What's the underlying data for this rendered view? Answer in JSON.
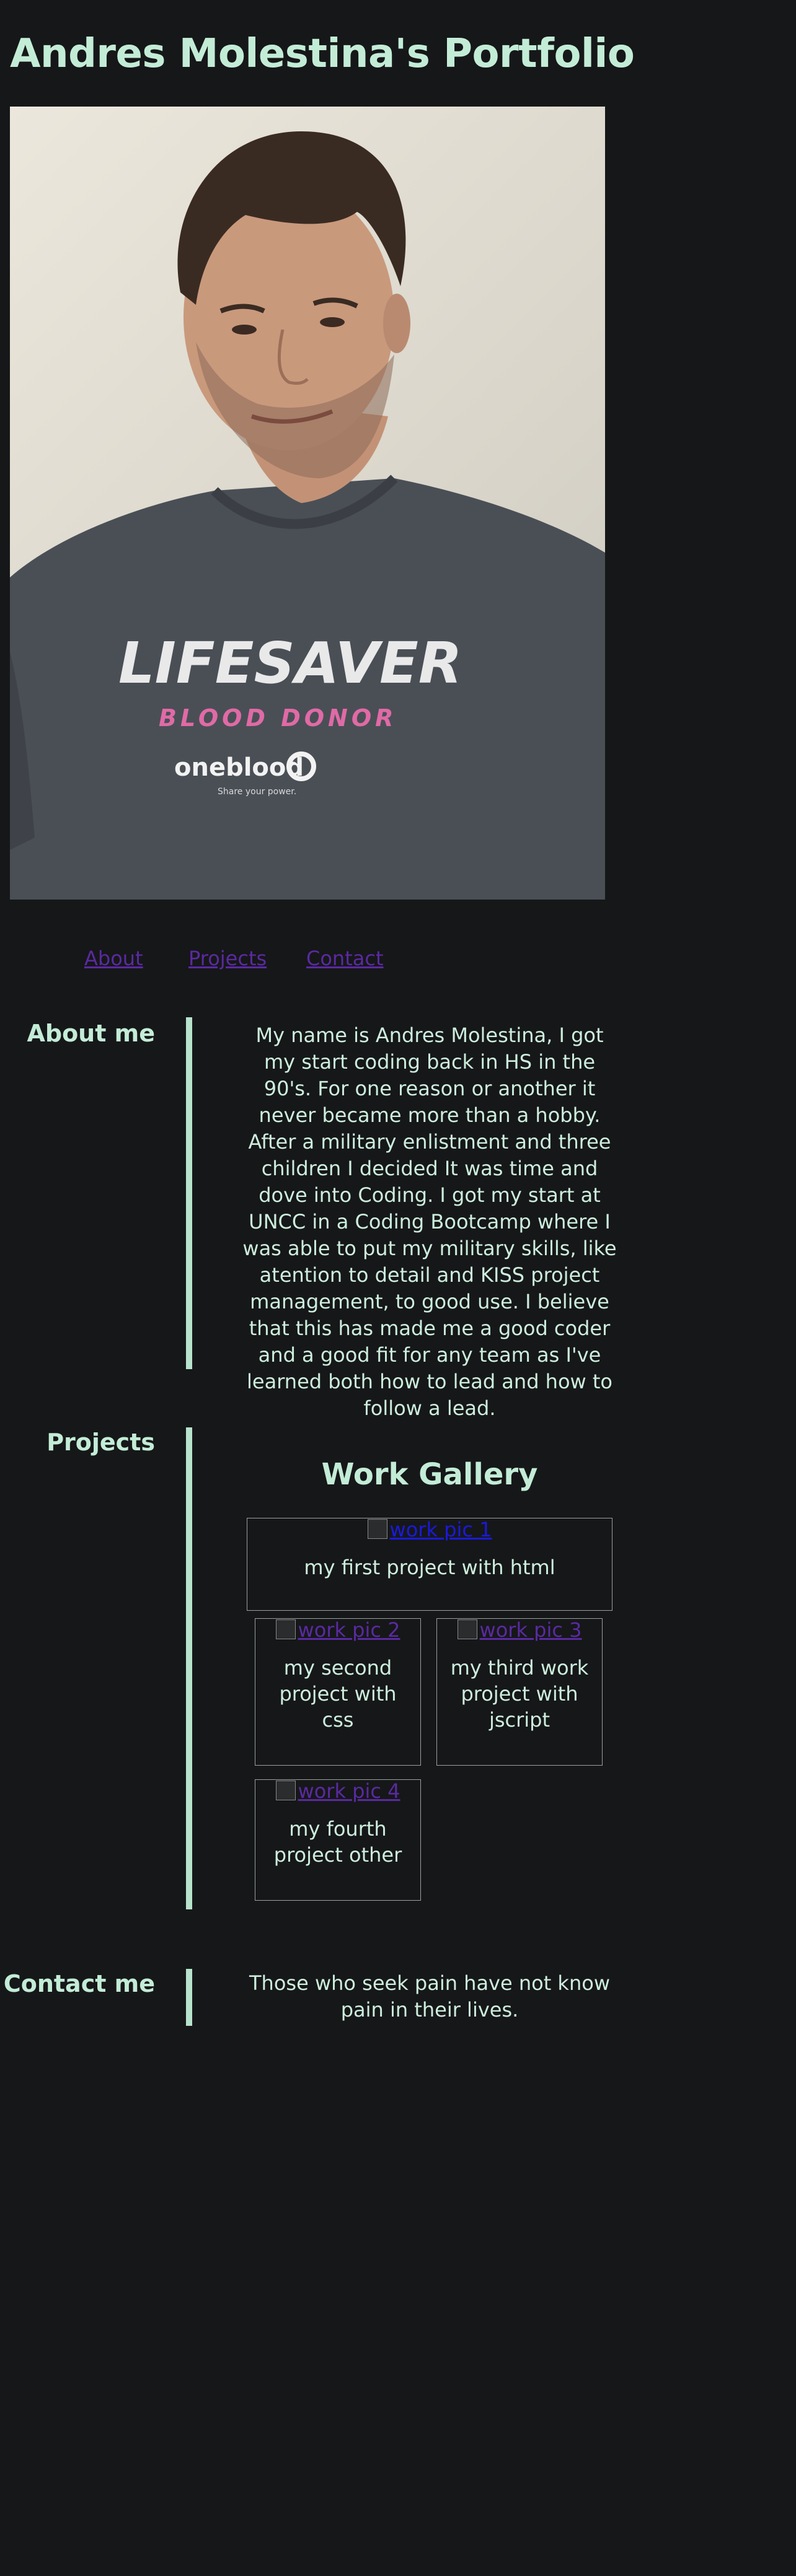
{
  "header": {
    "title": "Andres Molestina's Portfolio"
  },
  "nav": {
    "about": "About",
    "projects": "Projects",
    "contact": "Contact"
  },
  "about": {
    "heading": "About me",
    "body": "My name is Andres Molestina, I got my start coding back in HS in the 90's. For one reason or another it never became more than a hobby. After a military enlistment and three children I decided It was time and dove into Coding. I got my start at UNCC in a Coding Bootcamp where I was able to put my military skills, like atention to detail and KISS project management, to good use. I believe that this has made me a good coder and a good fit for any team as I've learned both how to lead and how to follow a lead."
  },
  "projects": {
    "heading": "Projects",
    "gallery_title": "Work Gallery",
    "items": [
      {
        "alt": "work pic 1",
        "caption": "my first project with html"
      },
      {
        "alt": "work pic 2",
        "caption": "my second project with css"
      },
      {
        "alt": "work pic 3",
        "caption": "my third work project with jscript"
      },
      {
        "alt": "work pic 4",
        "caption": "my fourth project other"
      }
    ]
  },
  "contact": {
    "heading": "Contact me",
    "body": "Those who seek pain have not know pain in their lives."
  },
  "profile_photo": {
    "shirt_text": "LIFESAVER",
    "shirt_subtext": "BLOOD DONOR",
    "shirt_brand": "oneblood",
    "shirt_tagline": "Share your power."
  },
  "colors": {
    "background": "#161719",
    "accent": "#c3ecd7",
    "link_visited": "#5a2aa0",
    "rule": "#b7e3cc"
  }
}
